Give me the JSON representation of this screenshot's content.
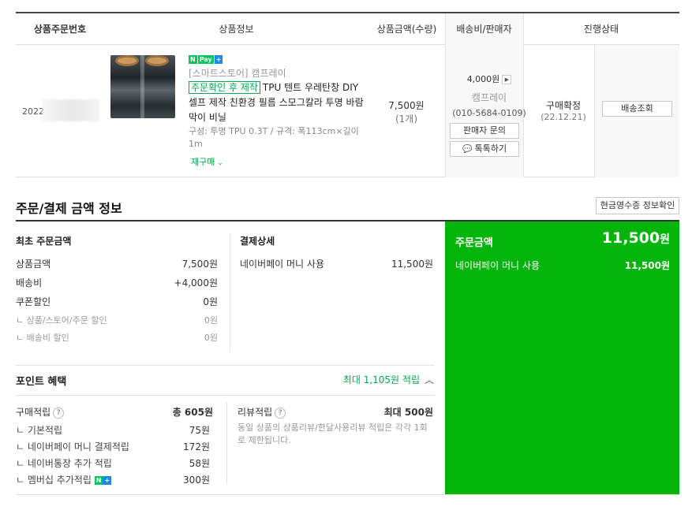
{
  "table": {
    "headers": {
      "order_no": "상품주문번호",
      "product": "상품정보",
      "amount": "상품금액(수량)",
      "shipping": "배송비/판매자",
      "status": "진행상태"
    },
    "row": {
      "order_no": "202212",
      "npay": "N",
      "npay_badge": "Pay",
      "npay_plus": "+",
      "store": "[스마트스토어] 캠프레이",
      "tag": "주문확인 후 제작",
      "title": "TPU 텐트 우레탄창 DIY 셀프 제작 친환경 필름 스모그칼라 투명 바람막이 비닐",
      "option": "구성: 투명 TPU 0.3T / 규격: 폭113cm×길이1m",
      "rebuy": "재구매",
      "price": "7,500원",
      "qty": "(1개)",
      "shipping_fee": "4,000원",
      "seller": "캠프레이",
      "phone": "(010-5684-0109)",
      "inquiry_btn": "판매자 문의",
      "talk_btn": "톡톡하기",
      "status": "구매확정",
      "status_date": "(22.12.21)",
      "track_btn": "배송조회"
    }
  },
  "payment": {
    "title": "주문/결제 금액 정보",
    "receipt_btn": "현금영수증 정보확인",
    "initial": {
      "title": "최초 주문금액",
      "rows": [
        {
          "label": "상품금액",
          "value": "7,500원"
        },
        {
          "label": "배송비",
          "value": "+4,000원"
        },
        {
          "label": "쿠폰할인",
          "value": "0원"
        }
      ],
      "sub_rows": [
        {
          "label": "ㄴ 상품/스토어/주문 할인",
          "value": "0원"
        },
        {
          "label": "ㄴ 배송비 할인",
          "value": "0원"
        }
      ]
    },
    "detail": {
      "title": "결제상세",
      "label": "네이버페이 머니 사용",
      "value": "11,500원"
    },
    "summary": {
      "label": "주문금액",
      "amount": "11,500",
      "won": "원",
      "sub_label": "네이버페이 머니 사용",
      "sub_value": "11,500원"
    }
  },
  "points": {
    "title": "포인트 혜택",
    "max": "최대 1,105원 적립",
    "purchase": {
      "title": "구매적립",
      "total": "총 605원",
      "rows": [
        {
          "label": "ㄴ 기본적립",
          "value": "75원"
        },
        {
          "label": "ㄴ 네이버페이 머니 결제적립",
          "value": "172원"
        },
        {
          "label": "ㄴ 네이버통장 추가 적립",
          "value": "58원"
        },
        {
          "label": "ㄴ 멤버십 추가적립",
          "value": "300원"
        }
      ]
    },
    "review": {
      "title": "리뷰적립",
      "max": "최대 500원",
      "note": "동일 상품의 상품리뷰/한달사용리뷰 적립은 각각 1회로 제한됩니다."
    }
  },
  "colors": {
    "accent_green": "#03b50b",
    "point_green": "#03a94e"
  }
}
